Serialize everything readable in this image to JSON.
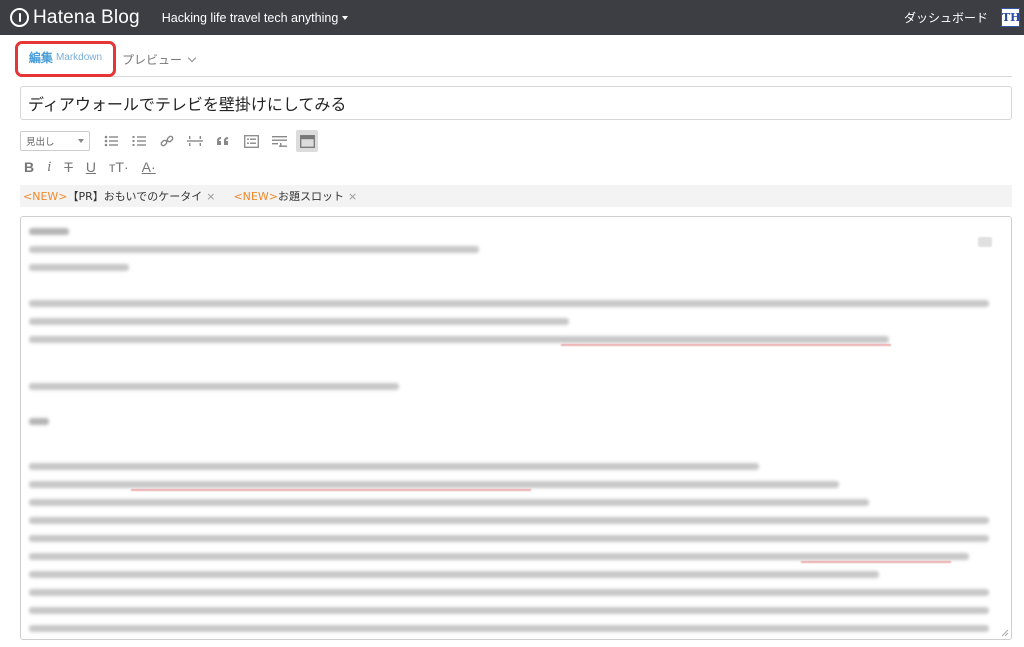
{
  "header": {
    "logo_text": "Hatena Blog",
    "blog_title": "Hacking life travel tech anything",
    "dashboard_label": "ダッシュボード",
    "avatar_text": "TH"
  },
  "tabs": {
    "edit_label": "編集",
    "edit_mode": "Markdown",
    "preview_label": "プレビュー"
  },
  "title_input": {
    "value": "ディアウォールでテレビを壁掛けにしてみる"
  },
  "toolbar": {
    "heading_select": "見出し",
    "row1_icons": [
      "unordered-list-icon",
      "ordered-list-icon",
      "link-icon",
      "horizontal-rule-icon",
      "quote-icon",
      "table-icon",
      "more-icon",
      "toggle-icon"
    ],
    "bold_label": "B",
    "italic_label": "i",
    "strike_label": "T",
    "underline_label": "U",
    "size_label": "тT·",
    "color_label": "A·"
  },
  "tags": [
    {
      "new": "<NEW>",
      "label": "【PR】おもいでのケータイ",
      "close": "×"
    },
    {
      "new": "<NEW>",
      "label": "お題スロット",
      "close": "×"
    }
  ],
  "colors": {
    "header_bg": "#3d3d44",
    "accent_blue": "#4a9fd8",
    "highlight_red": "#e53535",
    "new_orange": "#f08a2c"
  }
}
